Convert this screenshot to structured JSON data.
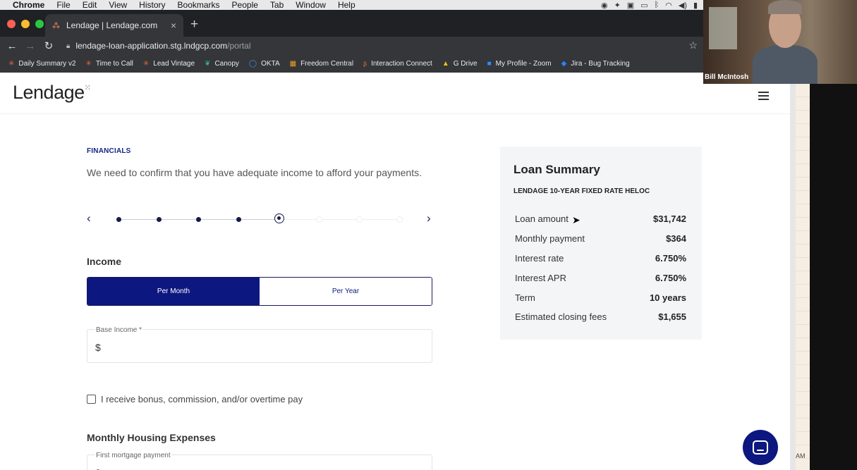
{
  "menubar": {
    "items": [
      "Chrome",
      "File",
      "Edit",
      "View",
      "History",
      "Bookmarks",
      "People",
      "Tab",
      "Window",
      "Help"
    ]
  },
  "browser": {
    "tab_title": "Lendage | Lendage.com",
    "url_host": "lendage-loan-application.stg.lndgcp.com",
    "url_path": "/portal",
    "bookmarks": [
      {
        "label": "Daily Summary v2",
        "icon": "asterisk-icon"
      },
      {
        "label": "Time to Call",
        "icon": "asterisk-icon"
      },
      {
        "label": "Lead Vintage",
        "icon": "asterisk-icon"
      },
      {
        "label": "Canopy",
        "icon": "leaf-icon"
      },
      {
        "label": "OKTA",
        "icon": "okta-icon"
      },
      {
        "label": "Freedom Central",
        "icon": "microsoft-icon"
      },
      {
        "label": "Interaction Connect",
        "icon": "connect-icon"
      },
      {
        "label": "G Drive",
        "icon": "drive-icon"
      },
      {
        "label": "My Profile - Zoom",
        "icon": "zoom-icon"
      },
      {
        "label": "Jira - Bug Tracking",
        "icon": "jira-icon"
      }
    ]
  },
  "page": {
    "logo": "Lendage",
    "section_label": "FINANCIALS",
    "intro": "We need to confirm that you have adequate income to afford your payments.",
    "stepper": {
      "total_steps": 8,
      "current_step": 5
    },
    "income_heading": "Income",
    "toggle": {
      "per_month": "Per Month",
      "per_year": "Per Year",
      "selected": "Per Month"
    },
    "base_income_label": "Base Income *",
    "currency_symbol": "$",
    "bonus_checkbox_label": "I receive bonus, commission, and/or overtime pay",
    "housing_heading": "Monthly Housing Expenses",
    "first_mortgage_label": "First mortgage payment"
  },
  "summary": {
    "title": "Loan Summary",
    "subtitle": "LENDAGE 10-YEAR FIXED RATE HELOC",
    "rows": [
      {
        "label": "Loan amount",
        "value": "$31,742"
      },
      {
        "label": "Monthly payment",
        "value": "$364"
      },
      {
        "label": "Interest rate",
        "value": "6.750%"
      },
      {
        "label": "Interest APR",
        "value": "6.750%"
      },
      {
        "label": "Term",
        "value": "10 years"
      },
      {
        "label": "Estimated closing fees",
        "value": "$1,655"
      }
    ]
  },
  "webcam": {
    "name": "Bill McIntosh"
  },
  "sheet": {
    "am_label": "AM"
  },
  "colors": {
    "brand_navy": "#0d1780",
    "summary_bg": "#f4f5f7"
  }
}
